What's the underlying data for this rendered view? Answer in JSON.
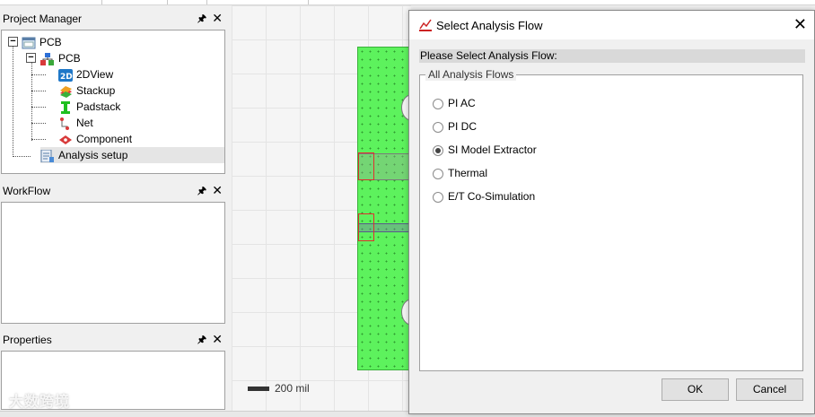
{
  "project_manager": {
    "title": "Project Manager",
    "tree": [
      {
        "label": "PCB",
        "icon": "project-icon",
        "level": 0
      },
      {
        "label": "PCB",
        "icon": "pcb-icon",
        "level": 1
      },
      {
        "label": "2DView",
        "icon": "2dview-icon",
        "level": 2
      },
      {
        "label": "Stackup",
        "icon": "stackup-icon",
        "level": 2
      },
      {
        "label": "Padstack",
        "icon": "padstack-icon",
        "level": 2
      },
      {
        "label": "Net",
        "icon": "net-icon",
        "level": 2
      },
      {
        "label": "Component",
        "icon": "component-icon",
        "level": 2
      },
      {
        "label": "Analysis setup",
        "icon": "analysis-setup-icon",
        "level": 1
      }
    ]
  },
  "workflow": {
    "title": "WorkFlow"
  },
  "properties": {
    "title": "Properties"
  },
  "canvas": {
    "scale_label": "200 mil",
    "board_color": "#5df25d"
  },
  "watermark": "大数跨境",
  "dialog": {
    "title": "Select Analysis Flow",
    "heading": "Please Select Analysis Flow:",
    "group_label": "All Analysis Flows",
    "options": [
      {
        "label": "PI AC",
        "checked": false
      },
      {
        "label": "PI DC",
        "checked": false
      },
      {
        "label": "SI Model Extractor",
        "checked": true
      },
      {
        "label": "Thermal",
        "checked": false
      },
      {
        "label": "E/T Co-Simulation",
        "checked": false
      }
    ],
    "ok_label": "OK",
    "cancel_label": "Cancel"
  }
}
